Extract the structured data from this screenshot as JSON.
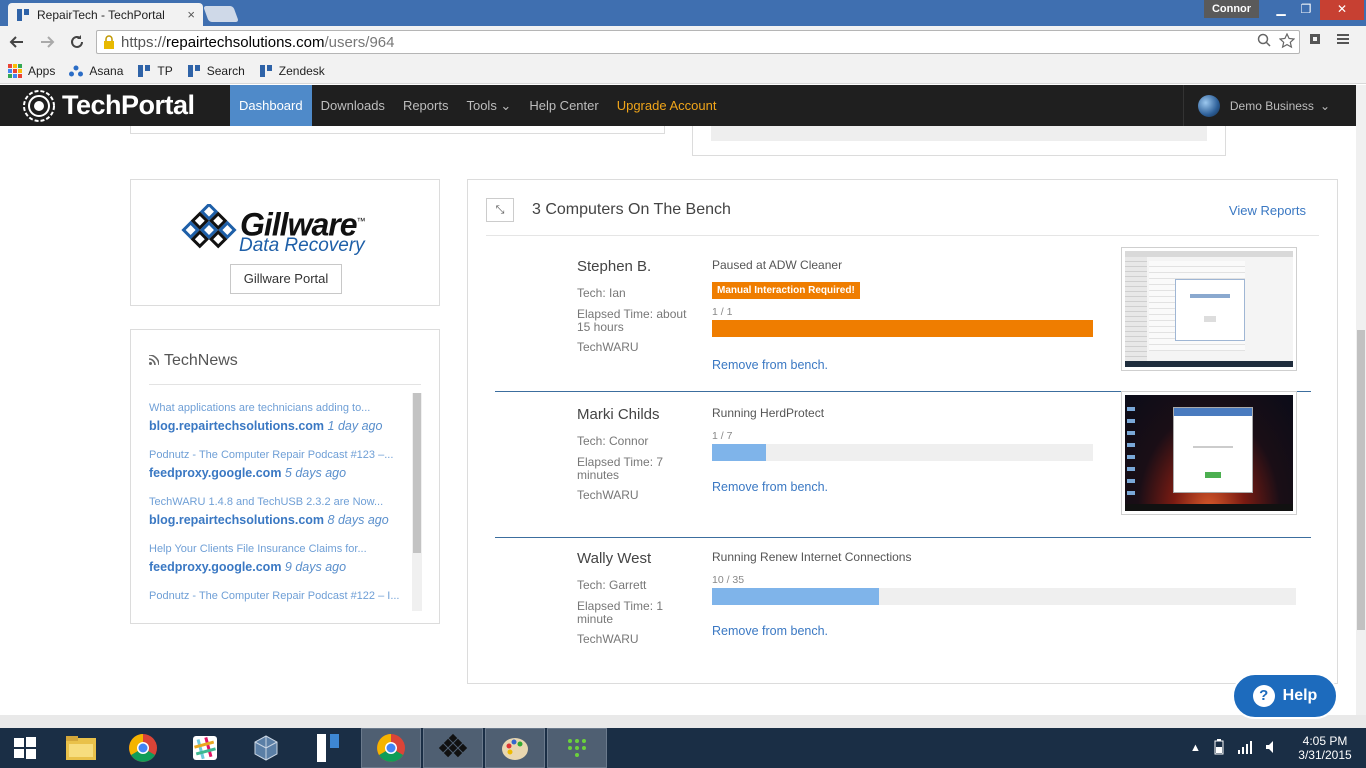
{
  "browser": {
    "tab_title": "RepairTech - TechPortal",
    "tab_close": "×",
    "profile_name": "Connor",
    "minimize": "▁",
    "maximize": "❐",
    "close": "✕",
    "url_scheme": "https://",
    "url_host": "repairtechsolutions.com",
    "url_path": "/users/964",
    "bookmarks": [
      "Apps",
      "Asana",
      "TP",
      "Search",
      "Zendesk"
    ]
  },
  "nav": {
    "brand": "TechPortal",
    "items": [
      {
        "label": "Dashboard"
      },
      {
        "label": "Downloads"
      },
      {
        "label": "Reports"
      },
      {
        "label": "Tools ⌄"
      },
      {
        "label": "Help Center"
      },
      {
        "label": "Upgrade Account"
      }
    ],
    "account": "Demo Business",
    "account_caret": "⌄"
  },
  "gillware": {
    "wordmark_primary": "Gillware",
    "wordmark_secondary": "Data Recovery",
    "trademark": "™",
    "button": "Gillware Portal"
  },
  "technews": {
    "heading": "TechNews",
    "items": [
      {
        "title": "What applications are technicians adding to...",
        "source": "blog.repairtechsolutions.com",
        "age": "1 day ago"
      },
      {
        "title": "Podnutz - The Computer Repair Podcast #123 –...",
        "source": "feedproxy.google.com",
        "age": "5 days ago"
      },
      {
        "title": "TechWARU 1.4.8 and TechUSB 2.3.2 are Now...",
        "source": "blog.repairtechsolutions.com",
        "age": "8 days ago"
      },
      {
        "title": "Help Your Clients File Insurance Claims for...",
        "source": "feedproxy.google.com",
        "age": "9 days ago"
      },
      {
        "title": "Podnutz - The Computer Repair Podcast #122 – I...",
        "source": "",
        "age": ""
      }
    ]
  },
  "bench": {
    "expand_icon": "⤡",
    "title": "3 Computers On The Bench",
    "view_reports": "View Reports",
    "computers": [
      {
        "name": "Stephen B.",
        "tech": "Tech: Ian",
        "elapsed": "Elapsed Time: about 15 hours",
        "app": "TechWARU",
        "status": "Paused at ADW Cleaner",
        "badge": "Manual Interaction Required!",
        "count": "1 / 1",
        "progress": 1.0,
        "bar_color": "#ef7d00",
        "remove": "Remove from bench."
      },
      {
        "name": "Marki Childs",
        "tech": "Tech: Connor",
        "elapsed": "Elapsed Time: 7 minutes",
        "app": "TechWARU",
        "status": "Running HerdProtect",
        "badge": "",
        "count": "1 / 7",
        "progress": 0.143,
        "bar_color": "#7fb4ea",
        "remove": "Remove from bench."
      },
      {
        "name": "Wally West",
        "tech": "Tech: Garrett",
        "elapsed": "Elapsed Time: 1 minute",
        "app": "TechWARU",
        "status": "Running Renew Internet Connections",
        "badge": "",
        "count": "10 / 35",
        "progress": 0.286,
        "bar_color": "#7fb4ea",
        "remove": "Remove from bench."
      }
    ]
  },
  "help_button": "Help",
  "help_icon": "?",
  "taskbar": {
    "time": "4:05 PM",
    "date": "3/31/2015"
  }
}
